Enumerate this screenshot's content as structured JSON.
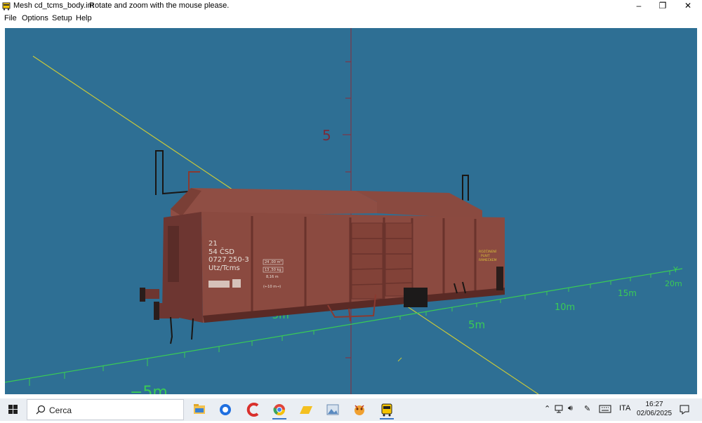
{
  "window": {
    "title": "Mesh cd_tcms_body.im",
    "hint": "Rotate and zoom with the mouse please.",
    "controls": {
      "minimize": "–",
      "maximize": "❐",
      "close": "✕"
    }
  },
  "menu": {
    "items": [
      "File",
      "Options",
      "Setup",
      "Help"
    ]
  },
  "viewport": {
    "background": "#2e6f94",
    "axes": {
      "z_tick_label": "5",
      "y_axis_label": "Y",
      "y_tick_labels": [
        "5m",
        "10m",
        "15m",
        "20m"
      ],
      "x_tick_labels": [
        "−5m",
        "−5m"
      ],
      "x_color": "#c8c83a",
      "y_color": "#3acb55",
      "z_color": "#8a2b3a"
    },
    "wagon": {
      "body_color": "#8b4a40",
      "marking_lines": [
        "21",
        "54 ČSD",
        "0727 250-3",
        "Utz/Tcms"
      ],
      "info_box": [
        "24 ,00 m³",
        "13 ,50 kg",
        "8,16 m",
        "(←10 m→)"
      ],
      "side_label": [
        "ROZČINENÍ",
        "PLNIT",
        "RÁMEČKEM"
      ]
    }
  },
  "taskbar": {
    "search_placeholder": "Cerca",
    "apps": [
      "file-explorer-icon",
      "firefox-icon",
      "ccleaner-icon",
      "chrome-icon",
      "folder-icon",
      "photos-icon",
      "emoji-app-icon",
      "train-app-icon"
    ],
    "tray": {
      "language": "ITA",
      "time": "16:27",
      "date": "02/06/2025"
    }
  }
}
